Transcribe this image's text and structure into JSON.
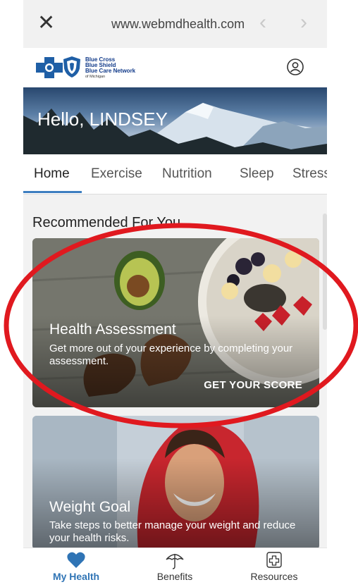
{
  "browser": {
    "url": "www.webmdhealth.com"
  },
  "header": {
    "logo_lines": [
      "Blue Cross",
      "Blue Shield",
      "Blue Care Network",
      "of Michigan"
    ]
  },
  "hero": {
    "greeting": "Hello, LINDSEY"
  },
  "tabs": [
    {
      "label": "Home",
      "active": true
    },
    {
      "label": "Exercise"
    },
    {
      "label": "Nutrition"
    },
    {
      "label": "Sleep"
    },
    {
      "label": "Stress"
    }
  ],
  "section": {
    "title": "Recommended For You"
  },
  "cards": [
    {
      "title": "Health Assessment",
      "description": "Get more out of your experience by completing your assessment.",
      "cta": "GET YOUR SCORE"
    },
    {
      "title": "Weight Goal",
      "description": "Take steps to better manage your weight and reduce your health risks."
    }
  ],
  "bottom_nav": [
    {
      "label": "My Health",
      "icon": "heart-icon",
      "active": true
    },
    {
      "label": "Benefits",
      "icon": "umbrella-icon"
    },
    {
      "label": "Resources",
      "icon": "medical-cross-icon"
    }
  ],
  "colors": {
    "accent": "#2f74b5",
    "annotation": "#e0191f"
  }
}
